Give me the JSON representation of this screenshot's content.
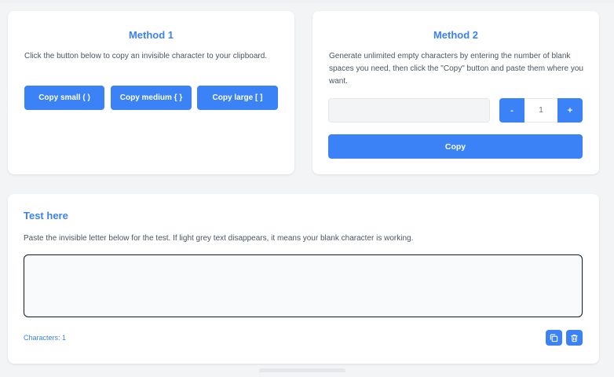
{
  "method1": {
    "title": "Method 1",
    "description": "Click the button below to copy an invisible character to your clipboard.",
    "buttons": {
      "small": "Copy small ( )",
      "medium": "Copy medium { }",
      "large": "Copy large [ ]"
    }
  },
  "method2": {
    "title": "Method 2",
    "description": "Generate unlimited empty characters by entering the number of blank spaces you need, then click the \"Copy\" button and paste them where you want.",
    "input_value": "",
    "stepper": {
      "minus": "-",
      "value": "1",
      "plus": "+"
    },
    "copy_label": "Copy"
  },
  "test": {
    "title": "Test here",
    "description": "Paste the invisible letter below for the test. If light grey text disappears, it means your blank character is working.",
    "textarea_value": "",
    "char_count": "Characters: 1",
    "icons": {
      "copy": "copy-icon",
      "trash": "trash-icon"
    }
  },
  "colors": {
    "accent": "#3b82f6",
    "background": "#f3f4f6",
    "card": "#ffffff"
  }
}
